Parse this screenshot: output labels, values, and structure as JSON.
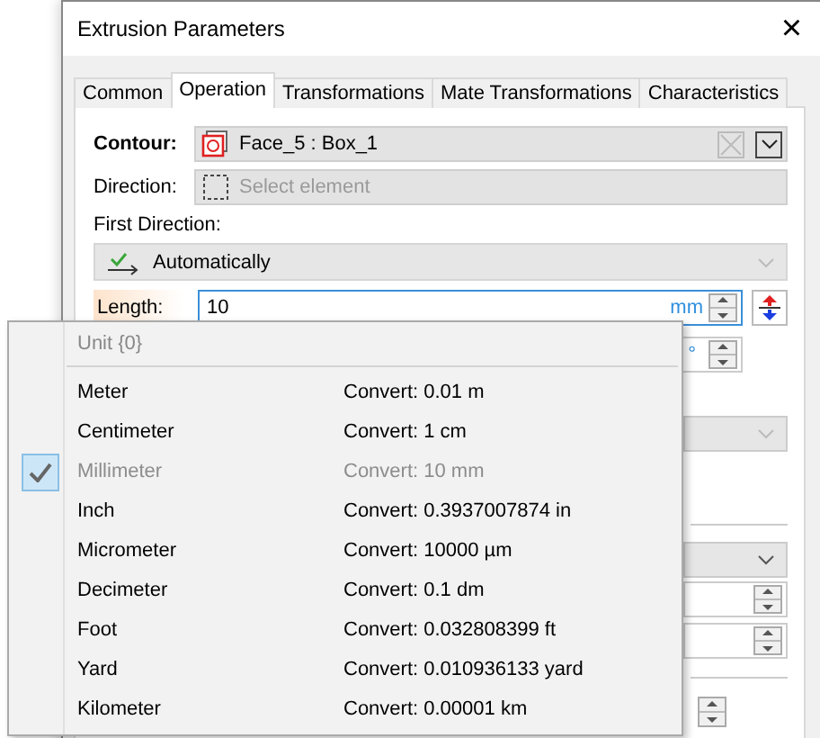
{
  "window": {
    "title": "Extrusion Parameters",
    "close": "×"
  },
  "tabs": [
    {
      "label": "Common",
      "selected": false
    },
    {
      "label": "Operation",
      "selected": true
    },
    {
      "label": "Transformations",
      "selected": false
    },
    {
      "label": "Mate Transformations",
      "selected": false
    },
    {
      "label": "Characteristics",
      "selected": false
    }
  ],
  "contour": {
    "label": "Contour:",
    "value": "Face_5 : Box_1"
  },
  "direction": {
    "label": "Direction:",
    "placeholder": "Select element"
  },
  "first_direction": {
    "label": "First Direction:",
    "value": "Automatically"
  },
  "length": {
    "label": "Length:",
    "value": "10",
    "unit": "mm"
  },
  "angle": {
    "unit": "°"
  },
  "unit_menu": {
    "header": "Unit {0}",
    "items": [
      {
        "name": "Meter",
        "conversion": "Convert: 0.01 m",
        "selected": false
      },
      {
        "name": "Centimeter",
        "conversion": "Convert: 1 cm",
        "selected": false
      },
      {
        "name": "Millimeter",
        "conversion": "Convert: 10 mm",
        "selected": true
      },
      {
        "name": "Inch",
        "conversion": "Convert: 0.3937007874 in",
        "selected": false
      },
      {
        "name": "Micrometer",
        "conversion": "Convert: 10000 µm",
        "selected": false
      },
      {
        "name": "Decimeter",
        "conversion": "Convert: 0.1 dm",
        "selected": false
      },
      {
        "name": "Foot",
        "conversion": "Convert: 0.032808399 ft",
        "selected": false
      },
      {
        "name": "Yard",
        "conversion": "Convert: 0.010936133 yard",
        "selected": false
      },
      {
        "name": "Kilometer",
        "conversion": "Convert: 0.00001 km",
        "selected": false
      }
    ]
  }
}
